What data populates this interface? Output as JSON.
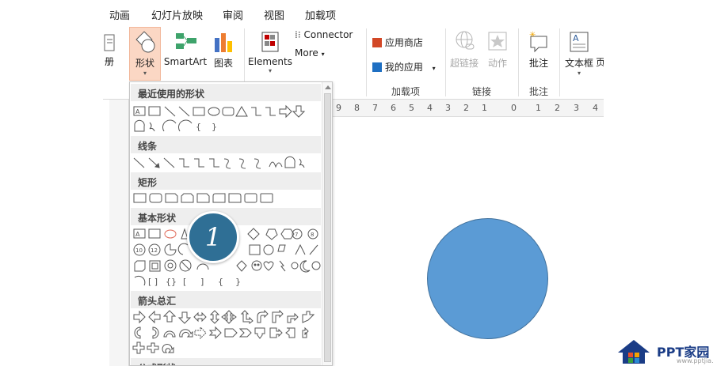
{
  "menu": {
    "tabs": [
      "动画",
      "幻灯片放映",
      "审阅",
      "视图",
      "加载项"
    ]
  },
  "ribbon": {
    "partial_left_label": "册",
    "shapes_label": "形状",
    "smartart_label": "SmartArt",
    "chart_label": "图表",
    "elements_label": "Elements",
    "connector_label": "Connector",
    "more_label": "More",
    "app_store_label": "应用商店",
    "my_apps_label": "我的应用",
    "addins_group_label": "加载项",
    "hyperlink_label": "超链接",
    "action_label": "动作",
    "links_group_label": "链接",
    "comment_label": "批注",
    "comments_group_label": "批注",
    "textbox_label": "文本框",
    "partial_right_label": "页"
  },
  "ruler": {
    "ticks": [
      "9",
      "8",
      "7",
      "6",
      "5",
      "4",
      "3",
      "2",
      "1",
      "0",
      "1",
      "2",
      "3",
      "4"
    ]
  },
  "shapes_panel": {
    "sections": [
      {
        "title": "最近使用的形状"
      },
      {
        "title": "线条"
      },
      {
        "title": "矩形"
      },
      {
        "title": "基本形状"
      },
      {
        "title": "箭头总汇"
      },
      {
        "title": "公式形状"
      }
    ]
  },
  "callout": {
    "number": "1"
  },
  "watermark": {
    "brand": "PPT家园",
    "url": "www.pptjia.com"
  },
  "colors": {
    "circle_fill": "#5b9bd5",
    "badge_fill": "#2f6f95",
    "selected_button": "#fbd7c4"
  }
}
